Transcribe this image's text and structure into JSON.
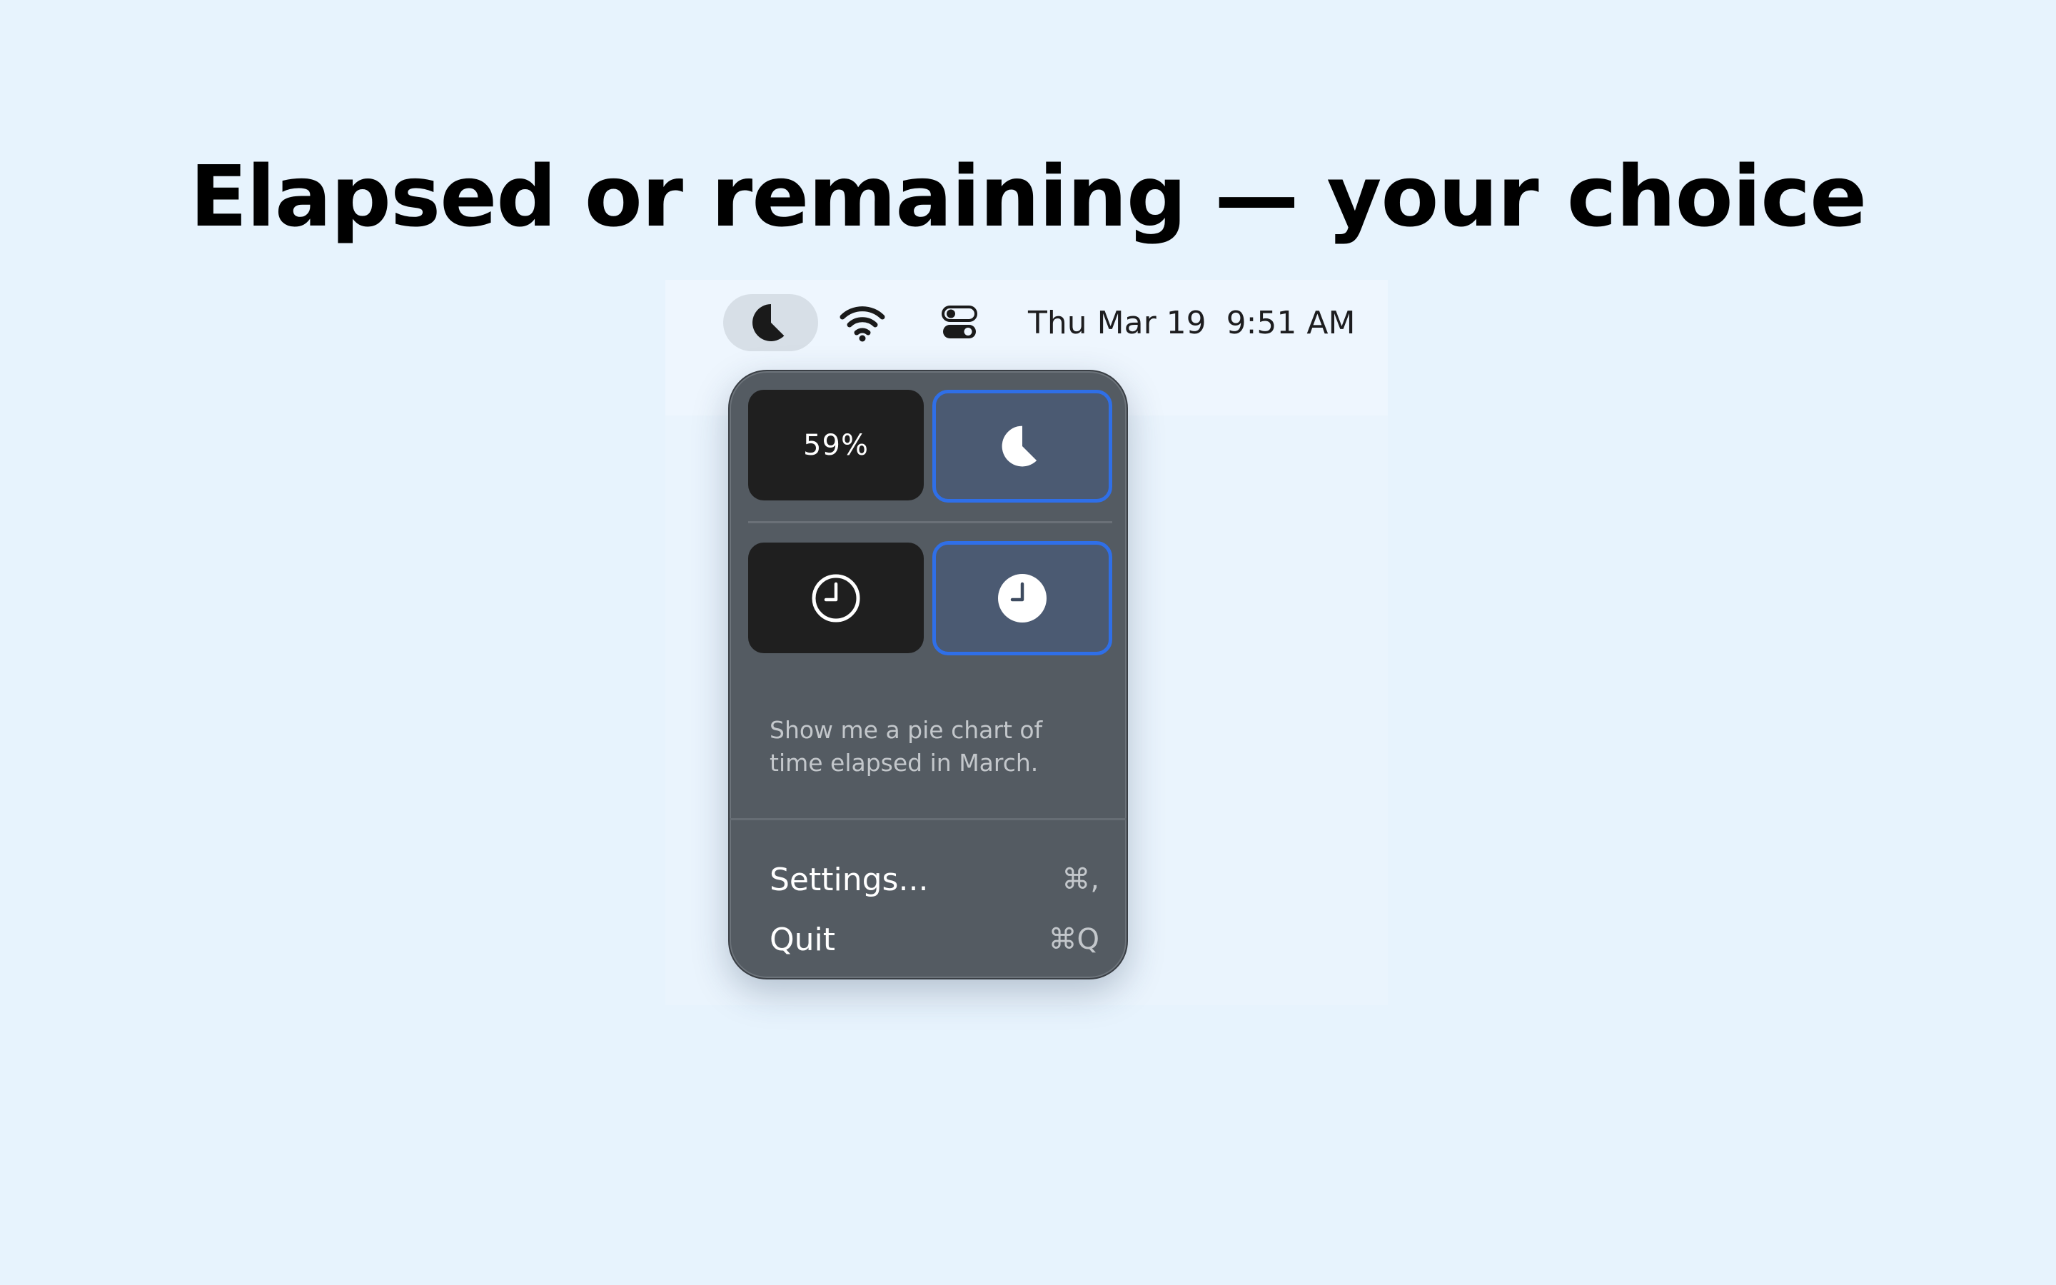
{
  "headline": "Elapsed or remaining — your choice",
  "menubar": {
    "app_icon": "pie-chart-icon",
    "wifi_icon": "wifi-icon",
    "control_center_icon": "control-center-icon",
    "clock": "Thu Mar 19  9:51 AM"
  },
  "popup": {
    "display_options": [
      {
        "label": "59%",
        "kind": "percent-text",
        "selected": false
      },
      {
        "icon": "pie-chart-icon",
        "kind": "pie",
        "selected": true
      }
    ],
    "mode_options": [
      {
        "icon": "clock-outline-icon",
        "kind": "remaining",
        "selected": false
      },
      {
        "icon": "clock-filled-icon",
        "kind": "elapsed",
        "selected": true
      }
    ],
    "description": "Show me a pie chart of time elapsed in March.",
    "menu": [
      {
        "label": "Settings...",
        "shortcut": "⌘,"
      },
      {
        "label": "Quit",
        "shortcut": "⌘Q"
      }
    ]
  },
  "colors": {
    "background": "#e7f3fd",
    "popup": "#545b62",
    "selected_border": "#2f6fe8",
    "selected_fill": "#4b5a72",
    "tile_dark": "#1f1f1f"
  }
}
